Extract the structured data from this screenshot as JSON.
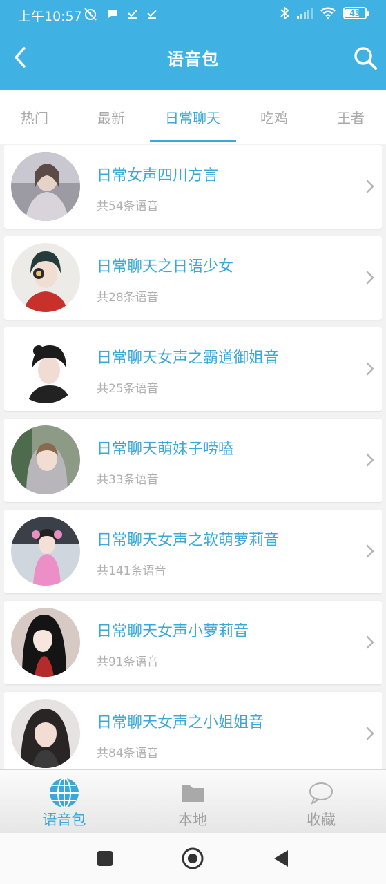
{
  "status": {
    "time": "上午10:57",
    "battery": "43",
    "left_icons": [
      "alarm-off-icon",
      "chat-bubble-icon",
      "download-done-icon",
      "download-done-icon"
    ],
    "right_icons": [
      "bluetooth-icon",
      "signal-icon",
      "wifi-icon",
      "battery-icon"
    ]
  },
  "header": {
    "title": "语音包",
    "back_icon": "back-arrow-icon",
    "search_icon": "search-icon",
    "color": "#3fb1e2"
  },
  "tabs": [
    {
      "label": "热门",
      "active": false
    },
    {
      "label": "最新",
      "active": false
    },
    {
      "label": "日常聊天",
      "active": true
    },
    {
      "label": "吃鸡",
      "active": false
    },
    {
      "label": "王者",
      "active": false
    }
  ],
  "items": [
    {
      "title": "日常女声四川方言",
      "count": "共54条语音"
    },
    {
      "title": "日常聊天之日语少女",
      "count": "共28条语音"
    },
    {
      "title": "日常聊天女声之霸道御姐音",
      "count": "共25条语音"
    },
    {
      "title": "日常聊天萌妹子唠嗑",
      "count": "共33条语音"
    },
    {
      "title": "日常聊天女声之软萌萝莉音",
      "count": "共141条语音"
    },
    {
      "title": "日常聊天女声小萝莉音",
      "count": "共91条语音"
    },
    {
      "title": "日常聊天女声之小姐姐音",
      "count": "共84条语音"
    }
  ],
  "bottom_nav": [
    {
      "label": "语音包",
      "icon": "globe-icon",
      "active": true
    },
    {
      "label": "本地",
      "icon": "folder-icon",
      "active": false
    },
    {
      "label": "收藏",
      "icon": "speech-bubble-icon",
      "active": false
    }
  ],
  "accent_color": "#3aa9d8"
}
